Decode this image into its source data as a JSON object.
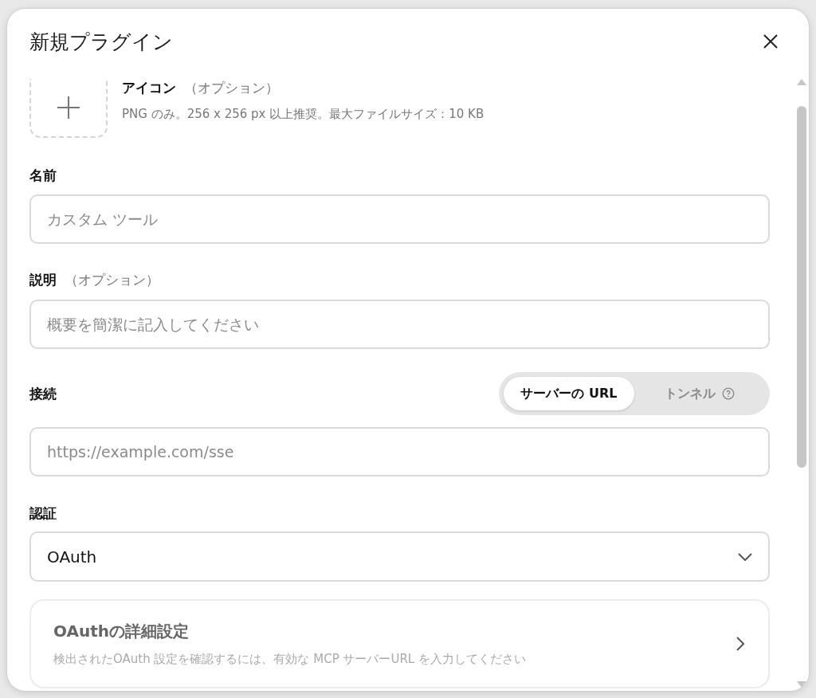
{
  "window": {
    "title": "新規プラグイン"
  },
  "icon_upload": {
    "label": "アイコン",
    "optional": "（オプション）",
    "hint": "PNG のみ。256 x 256 px 以上推奨。最大ファイルサイズ：10 KB"
  },
  "name": {
    "label": "名前",
    "placeholder": "カスタム ツール"
  },
  "description": {
    "label": "説明",
    "optional": "（オプション）",
    "placeholder": "概要を簡潔に記入してください"
  },
  "connection": {
    "label": "接続",
    "modes": [
      {
        "label": "サーバーの URL",
        "selected": true,
        "help": false
      },
      {
        "label": "トンネル",
        "selected": false,
        "help": true
      }
    ],
    "placeholder": "https://example.com/sse"
  },
  "auth": {
    "label": "認証",
    "value": "OAuth"
  },
  "oauth_card": {
    "title": "OAuthの詳細設定",
    "description": "検出されたOAuth 設定を確認するには、有効な MCP サーバーURL を入力してください"
  }
}
